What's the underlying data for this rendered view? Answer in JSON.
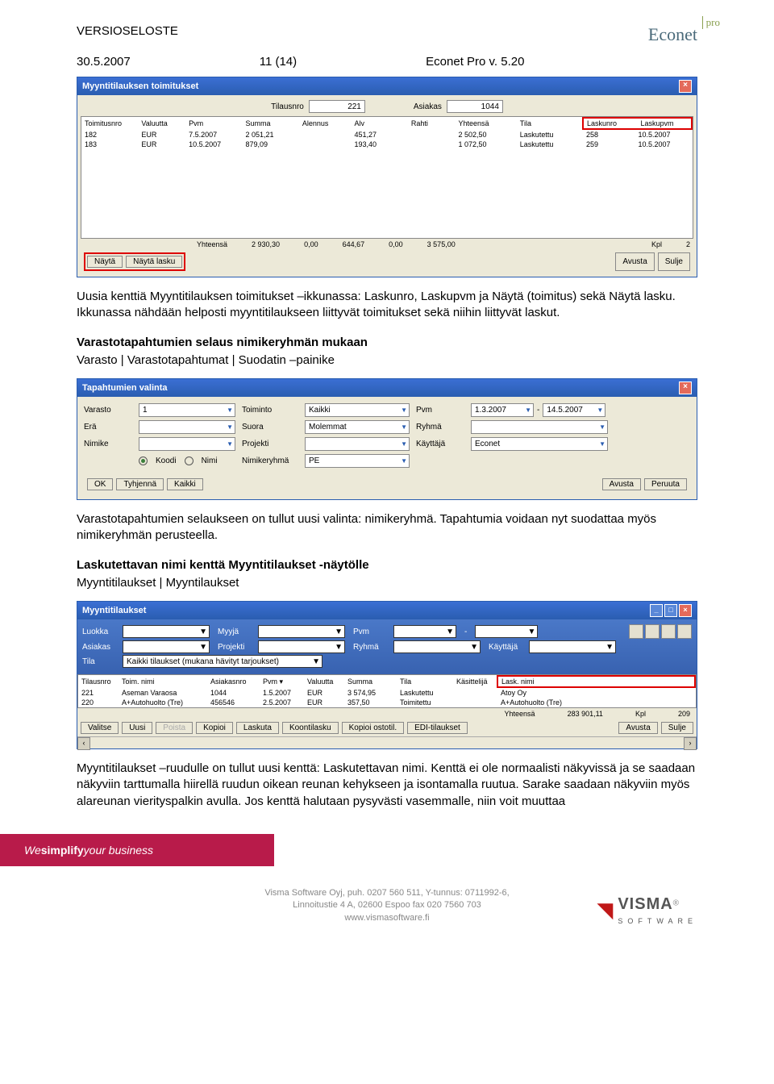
{
  "header": {
    "doc_title": "VERSIOSELOSTE",
    "date": "30.5.2007",
    "page": "11 (14)",
    "product": "Econet Pro v. 5.20",
    "logo_main": "Econet",
    "logo_sup": "pro"
  },
  "win1": {
    "title": "Myyntitilauksen toimitukset",
    "lbl_tilausnro": "Tilausnro",
    "val_tilausnro": "221",
    "lbl_asiakas": "Asiakas",
    "val_asiakas": "1044",
    "cols": [
      "Toimitusnro",
      "Valuutta",
      "Pvm",
      "Summa",
      "Alennus",
      "Alv",
      "Rahti",
      "Yhteensä",
      "Tila",
      "Laskunro",
      "Laskupvm"
    ],
    "rows": [
      [
        "182",
        "EUR",
        "7.5.2007",
        "2 051,21",
        "",
        "451,27",
        "",
        "2 502,50",
        "Laskutettu",
        "258",
        "10.5.2007"
      ],
      [
        "183",
        "EUR",
        "10.5.2007",
        "879,09",
        "",
        "193,40",
        "",
        "1 072,50",
        "Laskutettu",
        "259",
        "10.5.2007"
      ]
    ],
    "totals": {
      "lbl": "Yhteensä",
      "summa": "2 930,30",
      "al": "0,00",
      "alv": "644,67",
      "rahti": "0,00",
      "yht": "3 575,00",
      "kpl_lbl": "Kpl",
      "kpl": "2"
    },
    "btn_nayta": "Näytä",
    "btn_nayta_lasku": "Näytä lasku",
    "btn_avusta": "Avusta",
    "btn_sulje": "Sulje"
  },
  "text1": {
    "p1": "Uusia kenttiä Myyntitilauksen toimitukset –ikkunassa: Laskunro, Laskupvm ja Näytä (toimitus) sekä Näytä lasku. Ikkunassa nähdään helposti myyntitilaukseen liittyvät toimitukset sekä niihin liittyvät laskut.",
    "h1": "Varastotapahtumien selaus nimikeryhmän mukaan",
    "p2": "Varasto | Varastotapahtumat | Suodatin –painike"
  },
  "win2": {
    "title": "Tapahtumien valinta",
    "lbl_varasto": "Varasto",
    "val_varasto": "1",
    "lbl_toiminto": "Toiminto",
    "val_toiminto": "Kaikki",
    "lbl_pvm": "Pvm",
    "val_pvm1": "1.3.2007",
    "val_pvm2": "14.5.2007",
    "lbl_era": "Erä",
    "val_era": "",
    "lbl_suora": "Suora",
    "val_suora": "Molemmat",
    "lbl_ryhma": "Ryhmä",
    "val_ryhma": "",
    "lbl_nimike": "Nimike",
    "val_nimike": "",
    "lbl_projekti": "Projekti",
    "val_projekti": "",
    "lbl_kayttaja": "Käyttäjä",
    "val_kayttaja": "Econet",
    "radio_koodi": "Koodi",
    "radio_nimi": "Nimi",
    "lbl_nimikeryhma": "Nimikeryhmä",
    "val_nimikeryhma": "PE",
    "btn_ok": "OK",
    "btn_tyhjenna": "Tyhjennä",
    "btn_kaikki": "Kaikki",
    "btn_avusta": "Avusta",
    "btn_peruuta": "Peruuta"
  },
  "text2": {
    "p3": "Varastotapahtumien selaukseen on tullut uusi valinta: nimikeryhmä. Tapahtumia voidaan nyt suodattaa myös nimikeryhmän perusteella.",
    "h2": "Laskutettavan nimi kenttä Myyntitilaukset -näytölle",
    "p4": "Myyntitilaukset | Myyntilaukset"
  },
  "win3": {
    "title": "Myyntitilaukset",
    "lbl_luokka": "Luokka",
    "lbl_myyja": "Myyjä",
    "lbl_pvm": "Pvm",
    "lbl_asiakas": "Asiakas",
    "lbl_projekti": "Projekti",
    "lbl_ryhma": "Ryhmä",
    "lbl_kayttaja": "Käyttäjä",
    "lbl_tila": "Tila",
    "val_tila": "Kaikki tilaukset (mukana hävityt tarjoukset)",
    "cols": [
      "Tilausnro",
      "Toim. nimi",
      "Asiakasnro",
      "Pvm ▾",
      "Valuutta",
      "Summa",
      "Tila",
      "Käsittelijä",
      "Lask. nimi"
    ],
    "rows": [
      [
        "221",
        "Aseman Varaosa",
        "1044",
        "1.5.2007",
        "EUR",
        "3 574,95",
        "Laskutettu",
        "",
        "Atoy Oy"
      ],
      [
        "220",
        "A+Autohuolto (Tre)",
        "456546",
        "2.5.2007",
        "EUR",
        "357,50",
        "Toimitettu",
        "",
        "A+Autohuolto (Tre)"
      ]
    ],
    "totals": {
      "lbl": "Yhteensä",
      "val": "283 901,11",
      "kpl_lbl": "Kpl",
      "kpl": "209"
    },
    "btns": [
      "Valitse",
      "Uusi",
      "Poista",
      "Kopioi",
      "Laskuta",
      "Koontilasku",
      "Kopioi ostotil.",
      "EDI-tilaukset"
    ],
    "btn_avusta": "Avusta",
    "btn_sulje": "Sulje"
  },
  "text3": {
    "p5": "Myyntitilaukset –ruudulle on tullut uusi kenttä: Laskutettavan nimi. Kenttä ei ole normaalisti näkyvissä ja se saadaan näkyviin tarttumalla hiirellä ruudun oikean reunan kehykseen ja isontamalla ruutua. Sarake saadaan näkyviin myös alareunan vierityspalkin avulla. Jos kenttä halutaan pysyvästi vasemmalle, niin voit muuttaa"
  },
  "ribbon": {
    "we": "We ",
    "simplify": "simplify",
    "rest": " your business"
  },
  "footer": {
    "l1": "Visma Software Oyj, puh. 0207 560 511, Y-tunnus: 0711992-6,",
    "l2": "Linnoitustie 4 A, 02600 Espoo  fax 020 7560 703",
    "l3": "www.vismasoftware.fi",
    "visma": "VISMA",
    "soft": "SOFTWARE"
  }
}
